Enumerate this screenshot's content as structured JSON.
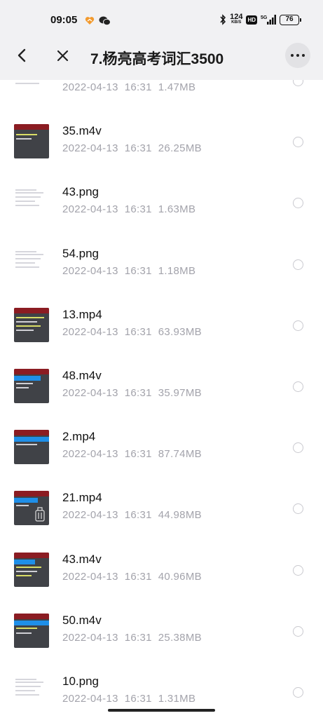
{
  "status_bar": {
    "time": "09:05",
    "net_speed_value": "124",
    "net_speed_unit": "KB/S",
    "hd_label": "HD",
    "network_label": "5G",
    "battery": "76"
  },
  "header": {
    "title": "7.杨亮高考词汇3500",
    "back_icon": "chevron-left-icon",
    "close_icon": "close-icon",
    "more_icon": "more-horizontal-icon"
  },
  "files": [
    {
      "name": "",
      "date": "2022-04-13",
      "time": "16:31",
      "size": "1.47MB",
      "kind": "image"
    },
    {
      "name": "35.m4v",
      "date": "2022-04-13",
      "time": "16:31",
      "size": "26.25MB",
      "kind": "video"
    },
    {
      "name": "43.png",
      "date": "2022-04-13",
      "time": "16:31",
      "size": "1.63MB",
      "kind": "image"
    },
    {
      "name": "54.png",
      "date": "2022-04-13",
      "time": "16:31",
      "size": "1.18MB",
      "kind": "image"
    },
    {
      "name": "13.mp4",
      "date": "2022-04-13",
      "time": "16:31",
      "size": "63.93MB",
      "kind": "video"
    },
    {
      "name": "48.m4v",
      "date": "2022-04-13",
      "time": "16:31",
      "size": "35.97MB",
      "kind": "video"
    },
    {
      "name": "2.mp4",
      "date": "2022-04-13",
      "time": "16:31",
      "size": "87.74MB",
      "kind": "video"
    },
    {
      "name": "21.mp4",
      "date": "2022-04-13",
      "time": "16:31",
      "size": "44.98MB",
      "kind": "video"
    },
    {
      "name": "43.m4v",
      "date": "2022-04-13",
      "time": "16:31",
      "size": "40.96MB",
      "kind": "video"
    },
    {
      "name": "50.m4v",
      "date": "2022-04-13",
      "time": "16:31",
      "size": "25.38MB",
      "kind": "video"
    },
    {
      "name": "10.png",
      "date": "2022-04-13",
      "time": "16:31",
      "size": "1.31MB",
      "kind": "image"
    }
  ],
  "colors": {
    "header_bg": "#f1f1f3",
    "meta_text": "#a3a3ab",
    "video_header": "#8b1c22",
    "video_body": "#404247",
    "accent_blue": "#1f8fe8"
  }
}
